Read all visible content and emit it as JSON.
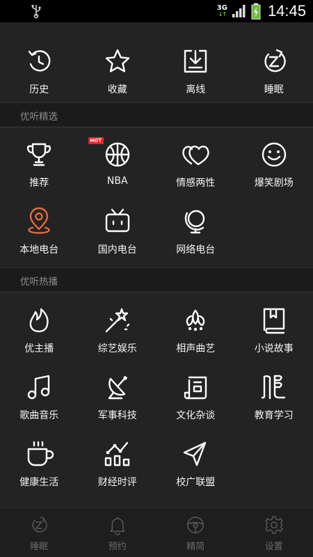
{
  "status_bar": {
    "network": "3G",
    "time": "14:45"
  },
  "quick_actions": [
    {
      "label": "历史",
      "icon": "history-icon"
    },
    {
      "label": "收藏",
      "icon": "star-icon"
    },
    {
      "label": "离线",
      "icon": "download-icon"
    },
    {
      "label": "睡眠",
      "icon": "sleep-timer-icon"
    }
  ],
  "sections": {
    "featured": {
      "title": "优听精选",
      "badge": "HOT",
      "items": [
        {
          "label": "推荐",
          "icon": "trophy-icon"
        },
        {
          "label": "NBA",
          "icon": "basketball-icon"
        },
        {
          "label": "情感两性",
          "icon": "hearts-icon"
        },
        {
          "label": "爆笑剧场",
          "icon": "smiley-icon"
        },
        {
          "label": "本地电台",
          "icon": "location-pin-icon",
          "accent": "#e46a3e"
        },
        {
          "label": "国内电台",
          "icon": "tv-icon"
        },
        {
          "label": "网络电台",
          "icon": "globe-icon"
        }
      ]
    },
    "hot": {
      "title": "优听热播",
      "items": [
        {
          "label": "优主播",
          "icon": "flame-icon"
        },
        {
          "label": "综艺娱乐",
          "icon": "magic-wand-icon"
        },
        {
          "label": "相声曲艺",
          "icon": "lotus-icon"
        },
        {
          "label": "小说故事",
          "icon": "book-icon"
        },
        {
          "label": "歌曲音乐",
          "icon": "music-note-icon"
        },
        {
          "label": "军事科技",
          "icon": "satellite-dish-icon"
        },
        {
          "label": "文化杂谈",
          "icon": "scroll-icon"
        },
        {
          "label": "教育学习",
          "icon": "education-icon"
        },
        {
          "label": "健康生活",
          "icon": "coffee-cup-icon"
        },
        {
          "label": "财经时评",
          "icon": "chart-icon"
        },
        {
          "label": "校广联盟",
          "icon": "paper-plane-icon"
        }
      ]
    }
  },
  "tab_bar": [
    {
      "label": "睡眠",
      "icon": "sleep-timer-icon"
    },
    {
      "label": "预约",
      "icon": "bell-icon"
    },
    {
      "label": "精简",
      "icon": "steering-wheel-icon"
    },
    {
      "label": "设置",
      "icon": "settings-gear-icon"
    }
  ]
}
